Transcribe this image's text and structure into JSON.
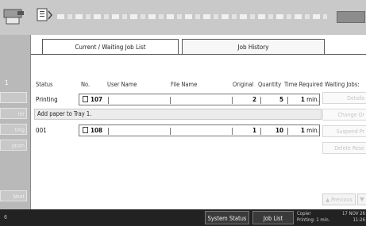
{
  "header": {
    "icons": [
      "printer-icon",
      "document-tray-icon"
    ],
    "status_badge_icon": "status-badge-icon"
  },
  "left_panel": {
    "count": "1",
    "buttons": [
      "ler",
      "ting",
      "ption"
    ],
    "next_label": "Next",
    "page_num": "6"
  },
  "tabs": [
    {
      "label": "Current / Waiting Job List",
      "active": true
    },
    {
      "label": "Job History",
      "active": false
    }
  ],
  "columns": {
    "status": "Status",
    "no": "No.",
    "user_name": "User Name",
    "file_name": "File Name",
    "original": "Original",
    "quantity": "Quantity",
    "time_required": "Time Required",
    "waiting_jobs": "Waiting Jobs:"
  },
  "jobs": [
    {
      "status": "Printing",
      "no": "107",
      "user_name": "",
      "file_name": "",
      "original": "2",
      "quantity": "5",
      "time": "1",
      "time_unit": "min."
    },
    {
      "status": "001",
      "no": "108",
      "user_name": "",
      "file_name": "",
      "original": "1",
      "quantity": "10",
      "time": "1",
      "time_unit": "min."
    }
  ],
  "message": "Add paper to Tray 1.",
  "right_buttons": {
    "details": "Details",
    "change_order": "Change Or",
    "suspend_printing": "Suspend Pr",
    "delete_reservation": "Delete Rese",
    "previous": "▲ Previous"
  },
  "footer": {
    "system_status": "System Status",
    "job_list": "Job List",
    "mode_line1": "Copier",
    "mode_line2": "Printing: 1 min.",
    "date_line1": "17 NOV  26",
    "date_line2": "11:26"
  },
  "colors": {
    "header_bg": "#c9c9c9",
    "footer_bg": "#222222",
    "panel_bg": "#ffffff"
  }
}
